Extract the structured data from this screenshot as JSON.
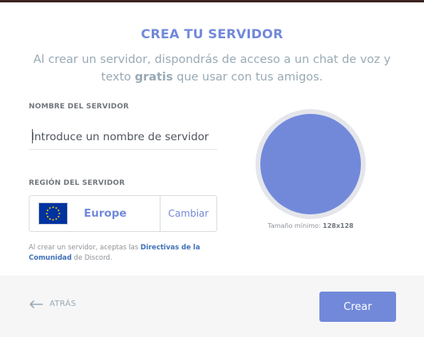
{
  "colors": {
    "accent": "#7289da",
    "link": "#3f70b8",
    "muted": "#99aab5",
    "footer_bg": "#f6f6f7"
  },
  "header": {
    "title": "CREA TU SERVIDOR",
    "subtitle_prefix": "Al crear un servidor, dispondrás de acceso a un chat de voz y texto ",
    "subtitle_strong": "gratis",
    "subtitle_suffix": " que usar con tus amigos."
  },
  "form": {
    "server_name_label": "NOMBRE DEL SERVIDOR",
    "server_name_placeholder": "Introduce un nombre de servidor",
    "server_name_value": "",
    "region_label": "REGIÓN DEL SERVIDOR",
    "region_icon": "eu-flag-icon",
    "region_name": "Europe",
    "region_change_label": "Cambiar"
  },
  "tos": {
    "prefix": "Al crear un servidor, aceptas las ",
    "link": "Directivas de la Comunidad",
    "suffix": " de Discord."
  },
  "avatar": {
    "min_size_label": "Tamaño mínimo: ",
    "min_size_value": "128x128"
  },
  "footer": {
    "back_icon": "arrow-left-icon",
    "back_label": "ATRÁS",
    "create_label": "Crear"
  }
}
